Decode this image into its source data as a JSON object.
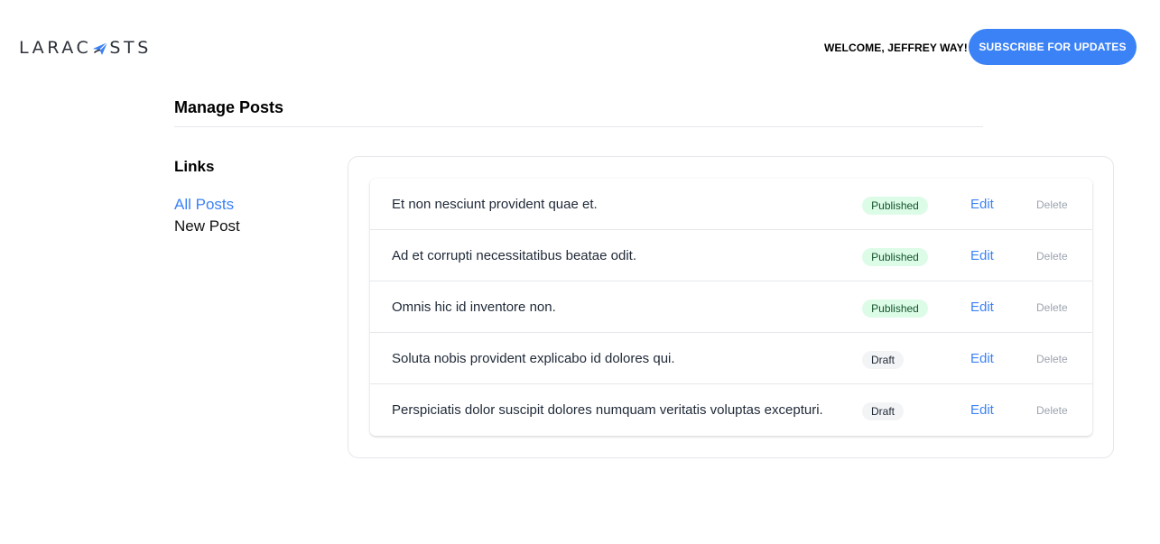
{
  "header": {
    "logo": {
      "text_before": "LARAC",
      "text_after": "STS",
      "mark_icon": "paper-plane-icon",
      "brand_color": "#2d3139",
      "accent_color": "#3b82f6"
    },
    "welcome": "WELCOME, JEFFREY WAY!",
    "subscribe_label": "SUBSCRIBE FOR UPDATES"
  },
  "page": {
    "title": "Manage Posts"
  },
  "sidebar": {
    "heading": "Links",
    "items": [
      {
        "label": "All Posts",
        "active": true
      },
      {
        "label": "New Post",
        "active": false
      }
    ]
  },
  "posts": [
    {
      "title": "Et non nesciunt provident quae et.",
      "status": "Published",
      "edit": "Edit",
      "delete": "Delete"
    },
    {
      "title": "Ad et corrupti necessitatibus beatae odit.",
      "status": "Published",
      "edit": "Edit",
      "delete": "Delete"
    },
    {
      "title": "Omnis hic id inventore non.",
      "status": "Published",
      "edit": "Edit",
      "delete": "Delete"
    },
    {
      "title": "Soluta nobis provident explicabo id dolores qui.",
      "status": "Draft",
      "edit": "Edit",
      "delete": "Delete"
    },
    {
      "title": "Perspiciatis dolor suscipit dolores numquam veritatis voluptas excepturi.",
      "status": "Draft",
      "edit": "Edit",
      "delete": "Delete"
    }
  ],
  "colors": {
    "primary": "#3b82f6",
    "published_bg": "#dcfce7",
    "published_text": "#14532d",
    "draft_bg": "#f3f4f6"
  }
}
